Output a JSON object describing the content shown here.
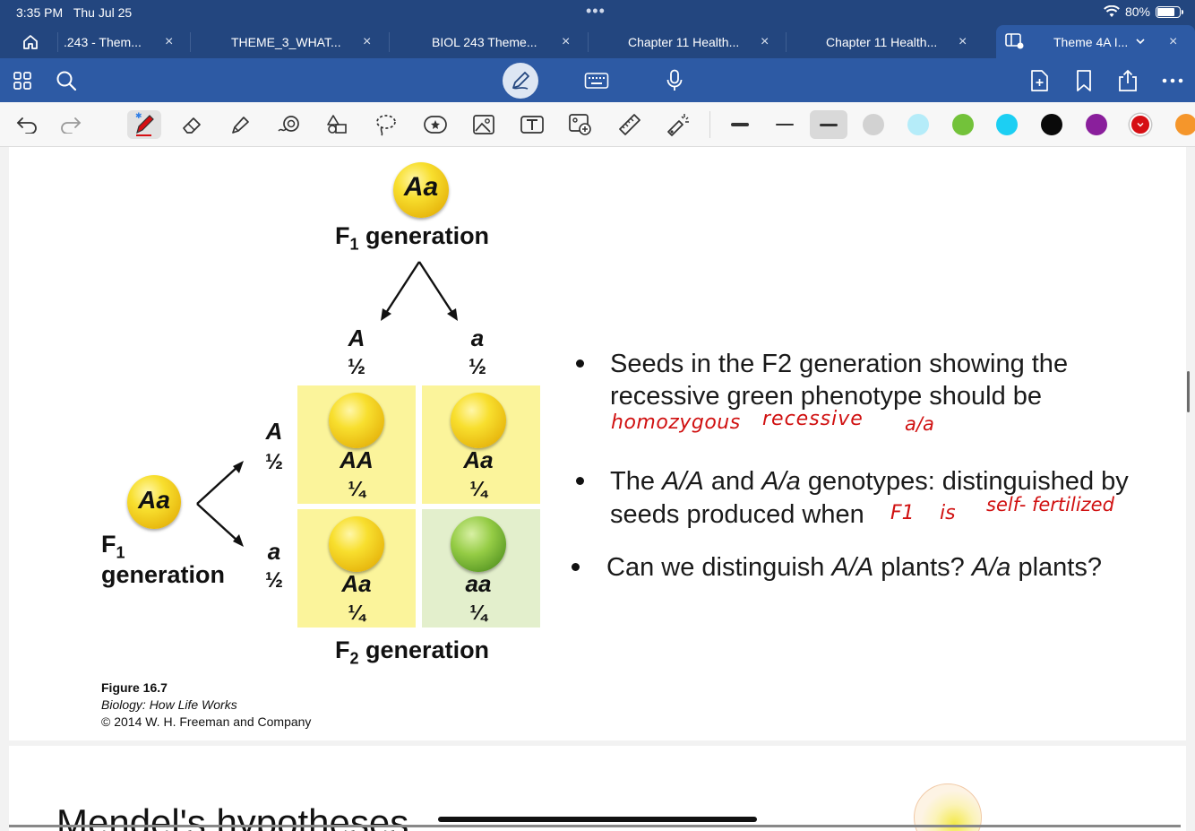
{
  "status_bar": {
    "time": "3:35 PM",
    "date": "Thu Jul 25",
    "battery": "80%",
    "battery_level": 0.8,
    "dots": "•••"
  },
  "tabs": [
    {
      "label": ".243 - Them...",
      "active": false
    },
    {
      "label": "THEME_3_WHAT...",
      "active": false
    },
    {
      "label": "BIOL 243 Theme...",
      "active": false
    },
    {
      "label": "Chapter 11 Health...",
      "active": false
    },
    {
      "label": "Chapter 11 Health...",
      "active": false
    },
    {
      "label": "Theme 4A I...",
      "active": true
    }
  ],
  "tab_close": "×",
  "toolbar": {
    "icons": [
      "grid-icon",
      "search-icon",
      "pen-mode-icon",
      "keyboard-icon",
      "microphone-icon",
      "add-page-icon",
      "bookmark-icon",
      "share-icon",
      "more-icon"
    ]
  },
  "tools": {
    "items": [
      "undo-icon",
      "redo-icon",
      "pen-icon",
      "eraser-icon",
      "highlighter-icon",
      "shape-icon",
      "elements-icon",
      "lasso-icon",
      "sticker-icon",
      "image-icon",
      "text-icon",
      "camera-icon",
      "ruler-icon",
      "laser-icon"
    ],
    "selected_tool": "pen-icon",
    "stroke_widths": [
      "thick",
      "thin",
      "medium"
    ],
    "selected_stroke": "medium",
    "colors": [
      "#d2d2d2",
      "#b5ecf9",
      "#73c23a",
      "#1ccff3",
      "#0a0a0a",
      "#8a1f9c",
      "#d60f14",
      "#f5962b"
    ],
    "selected_color": "#d60f14"
  },
  "figure": {
    "top_genotype": "Aa",
    "f1_generation": "generation",
    "f1_label": "F",
    "f1_sub": "1",
    "col_alleles": [
      {
        "allele": "A",
        "freq": "½"
      },
      {
        "allele": "a",
        "freq": "½"
      }
    ],
    "row_alleles": [
      {
        "allele": "A",
        "freq": "½"
      },
      {
        "allele": "a",
        "freq": "½"
      }
    ],
    "left_genotype": "Aa",
    "left_f1_label": "F",
    "left_f1_sub": "1",
    "left_generation": "generation",
    "cells": [
      {
        "genotype": "AA",
        "fraction": "¼",
        "color": "yellow"
      },
      {
        "genotype": "Aa",
        "fraction": "¼",
        "color": "yellow"
      },
      {
        "genotype": "Aa",
        "fraction": "¼",
        "color": "yellow"
      },
      {
        "genotype": "aa",
        "fraction": "¼",
        "color": "green"
      }
    ],
    "f2_label": "F",
    "f2_sub": "2",
    "f2_generation": "generation",
    "caption_title": "Figure 16.7",
    "caption_book": "Biology: How Life Works",
    "caption_copyright": "© 2014 W. H. Freeman and Company"
  },
  "bullets": [
    {
      "line1": "Seeds in the F2 generation showing the",
      "line2": "recessive green phenotype should be"
    },
    {
      "line1_a": "The ",
      "line1_b": "A/A",
      "line1_c": " and ",
      "line1_d": "A/a",
      "line1_e": " genotypes: distinguished by",
      "line2": "seeds produced when"
    },
    {
      "a": "Can we distinguish ",
      "b": "A/A",
      "c": " plants? ",
      "d": "A/a",
      "e": " plants?"
    }
  ],
  "handwriting": {
    "note1_word1": "homozygous",
    "note1_word2": "recessive",
    "note1_word3": "a/a",
    "note2_word1": "F1",
    "note2_word2": "is",
    "note2_word3": "self- fertilized"
  },
  "next_page_heading": "Mendel's hypotheses"
}
